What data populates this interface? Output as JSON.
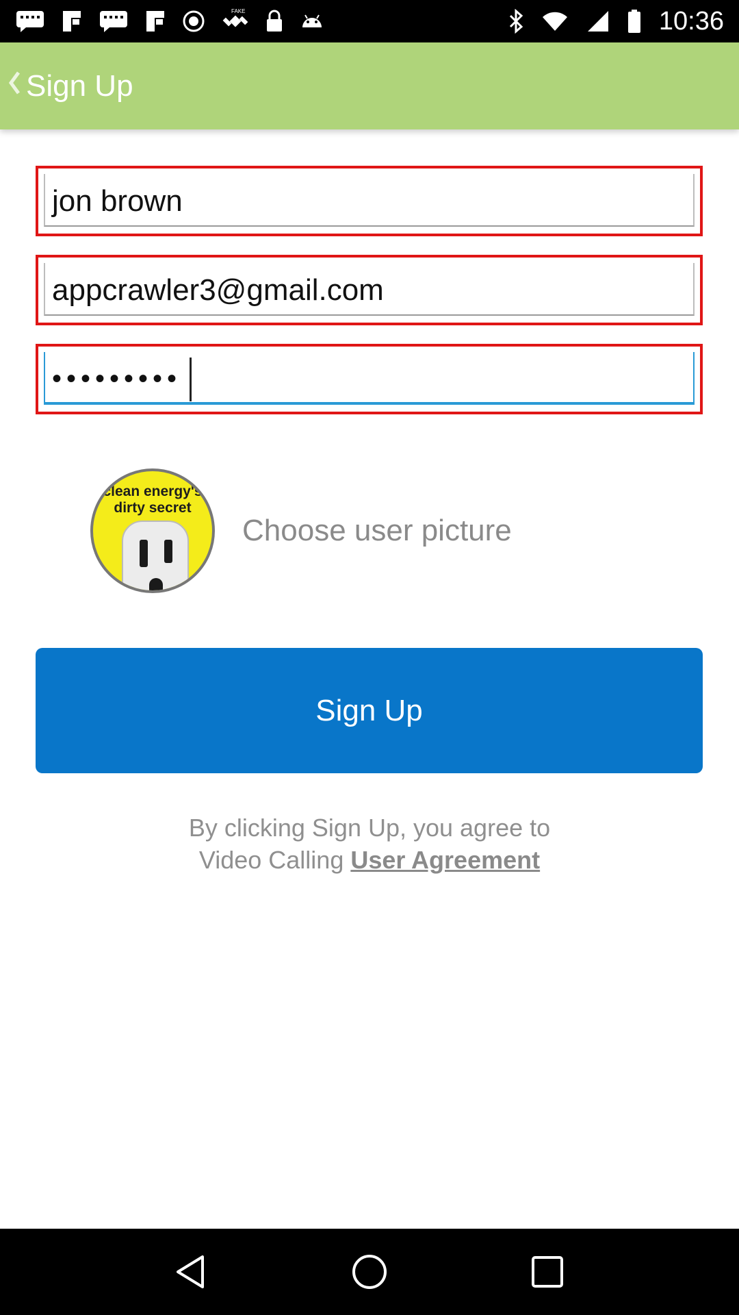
{
  "status_bar": {
    "time": "10:36",
    "left_icons": [
      "message-icon",
      "flipboard-icon",
      "message-icon",
      "flipboard-icon",
      "record-icon",
      "satellite-icon",
      "lock-icon",
      "android-icon"
    ],
    "right_icons": [
      "bluetooth-icon",
      "wifi-icon",
      "signal-icon",
      "battery-icon"
    ],
    "satellite_badge": "FAKE"
  },
  "action_bar": {
    "title": "Sign Up",
    "background_color": "#afd47a"
  },
  "form": {
    "name_value": "jon brown",
    "email_value": "appcrawler3@gmail.com",
    "password_mask": "•••••••••",
    "error_border_color": "#e01616"
  },
  "avatar": {
    "image_text": "clean energy's dirty secret",
    "choose_label": "Choose user picture"
  },
  "signup_button": {
    "label": "Sign Up",
    "color": "#0976c9"
  },
  "agreement": {
    "line1": "By clicking Sign Up, you agree to",
    "line2_prefix": "Video Calling ",
    "link_label": "User Agreement"
  },
  "nav_bar": {
    "buttons": [
      "back-icon",
      "home-icon",
      "recents-icon"
    ]
  }
}
